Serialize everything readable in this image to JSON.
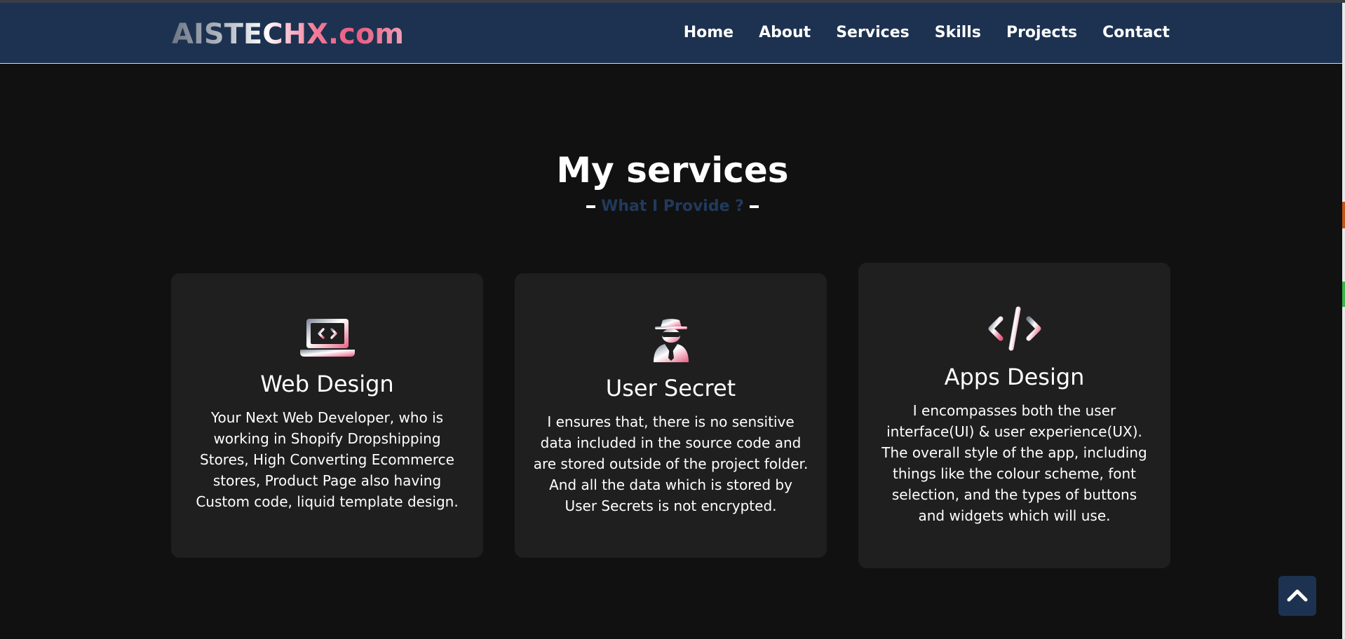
{
  "navbar": {
    "logo": "AISTECHX.com",
    "links": [
      "Home",
      "About",
      "Services",
      "Skills",
      "Projects",
      "Contact"
    ]
  },
  "section": {
    "title": "My services",
    "subtitle": "What I Provide ?"
  },
  "cards": [
    {
      "icon": "laptop-code-icon",
      "title": "Web Design",
      "text": "Your Next Web Developer, who is working in Shopify Dropshipping Stores, High Converting Ecommerce stores, Product Page also having Custom code, liquid template design."
    },
    {
      "icon": "user-secret-icon",
      "title": "User Secret",
      "text": "I ensures that, there is no sensitive data included in the source code and are stored outside of the project folder. And all the data which is stored by User Secrets is not encrypted."
    },
    {
      "icon": "code-icon",
      "title": "Apps Design",
      "text": "I encompasses both the user interface(UI) & user experience(UX). The overall style of the app, including things like the colour scheme, font selection, and the types of buttons and widgets which will use."
    }
  ],
  "scroll_top": {
    "icon": "chevron-up-icon"
  },
  "colors": {
    "background": "#111111",
    "navbar": "#1d3250",
    "card": "#1f1f1f",
    "accent_pink": "#e85c82",
    "subtitle": "#213a5c"
  }
}
